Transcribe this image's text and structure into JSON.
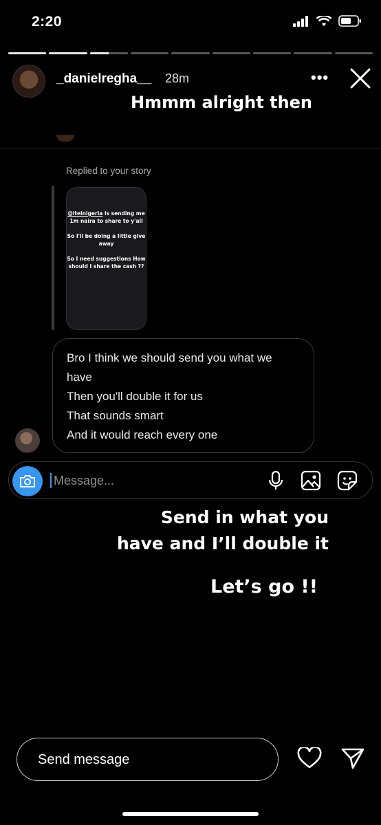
{
  "status_bar": {
    "time": "2:20",
    "icons": [
      "signal-icon",
      "wifi-icon",
      "battery-icon"
    ]
  },
  "story": {
    "progress_segments": 9,
    "progress_current_index": 2,
    "progress_current_fraction": 0.5,
    "username": "_danielregha__",
    "posted_ago": "28m",
    "overlay_text_top": "Hmmm alright then",
    "overlay_text_middle": "Send in what you have and I’ll double it",
    "overlay_text_bottom": "Let’s go !!"
  },
  "dm": {
    "replied_label": "Replied to your story",
    "story_preview": {
      "mention": "@itelnigeria",
      "line1_rest": " is sending me 1m naira to share to y'all",
      "line2": "So I'll be doing a little give away",
      "line3": "So I need suggestions How should I share the cash ??"
    },
    "message_lines": [
      "Bro I think we should send you what we",
      "have",
      "Then you'll double it for us",
      "That sounds smart",
      "And it would reach every one"
    ],
    "composer": {
      "placeholder": "Message..."
    }
  },
  "reply_bar": {
    "label": "Send message"
  },
  "colors": {
    "accent": "#3797f0",
    "background": "#000000"
  }
}
